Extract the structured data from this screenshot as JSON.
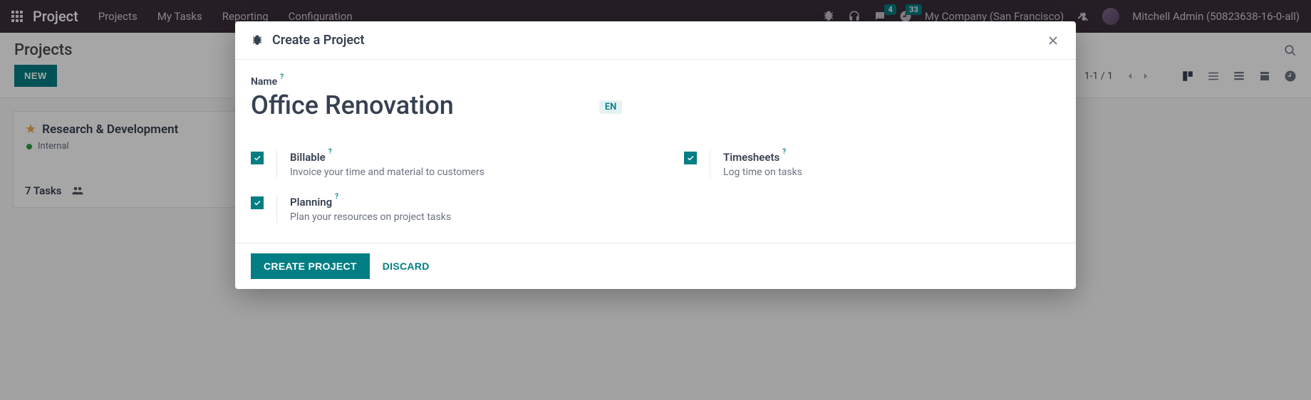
{
  "nav": {
    "brand": "Project",
    "items": [
      "Projects",
      "My Tasks",
      "Reporting",
      "Configuration"
    ],
    "chat_badge": "4",
    "activity_badge": "33",
    "company": "My Company (San Francisco)",
    "user": "Mitchell Admin (50823638-16-0-all)"
  },
  "controls": {
    "title": "Projects",
    "new_button": "NEW",
    "pager": "1-1 / 1"
  },
  "card": {
    "title": "Research & Development",
    "tag": "Internal",
    "tasks": "7 Tasks"
  },
  "modal": {
    "title": "Create a Project",
    "name_label": "Name",
    "name_value": "Office Renovation",
    "lang": "EN",
    "options": {
      "billable": {
        "label": "Billable",
        "desc": "Invoice your time and material to customers"
      },
      "planning": {
        "label": "Planning",
        "desc": "Plan your resources on project tasks"
      },
      "timesheets": {
        "label": "Timesheets",
        "desc": "Log time on tasks"
      }
    },
    "create_button": "CREATE PROJECT",
    "discard_button": "DISCARD"
  }
}
